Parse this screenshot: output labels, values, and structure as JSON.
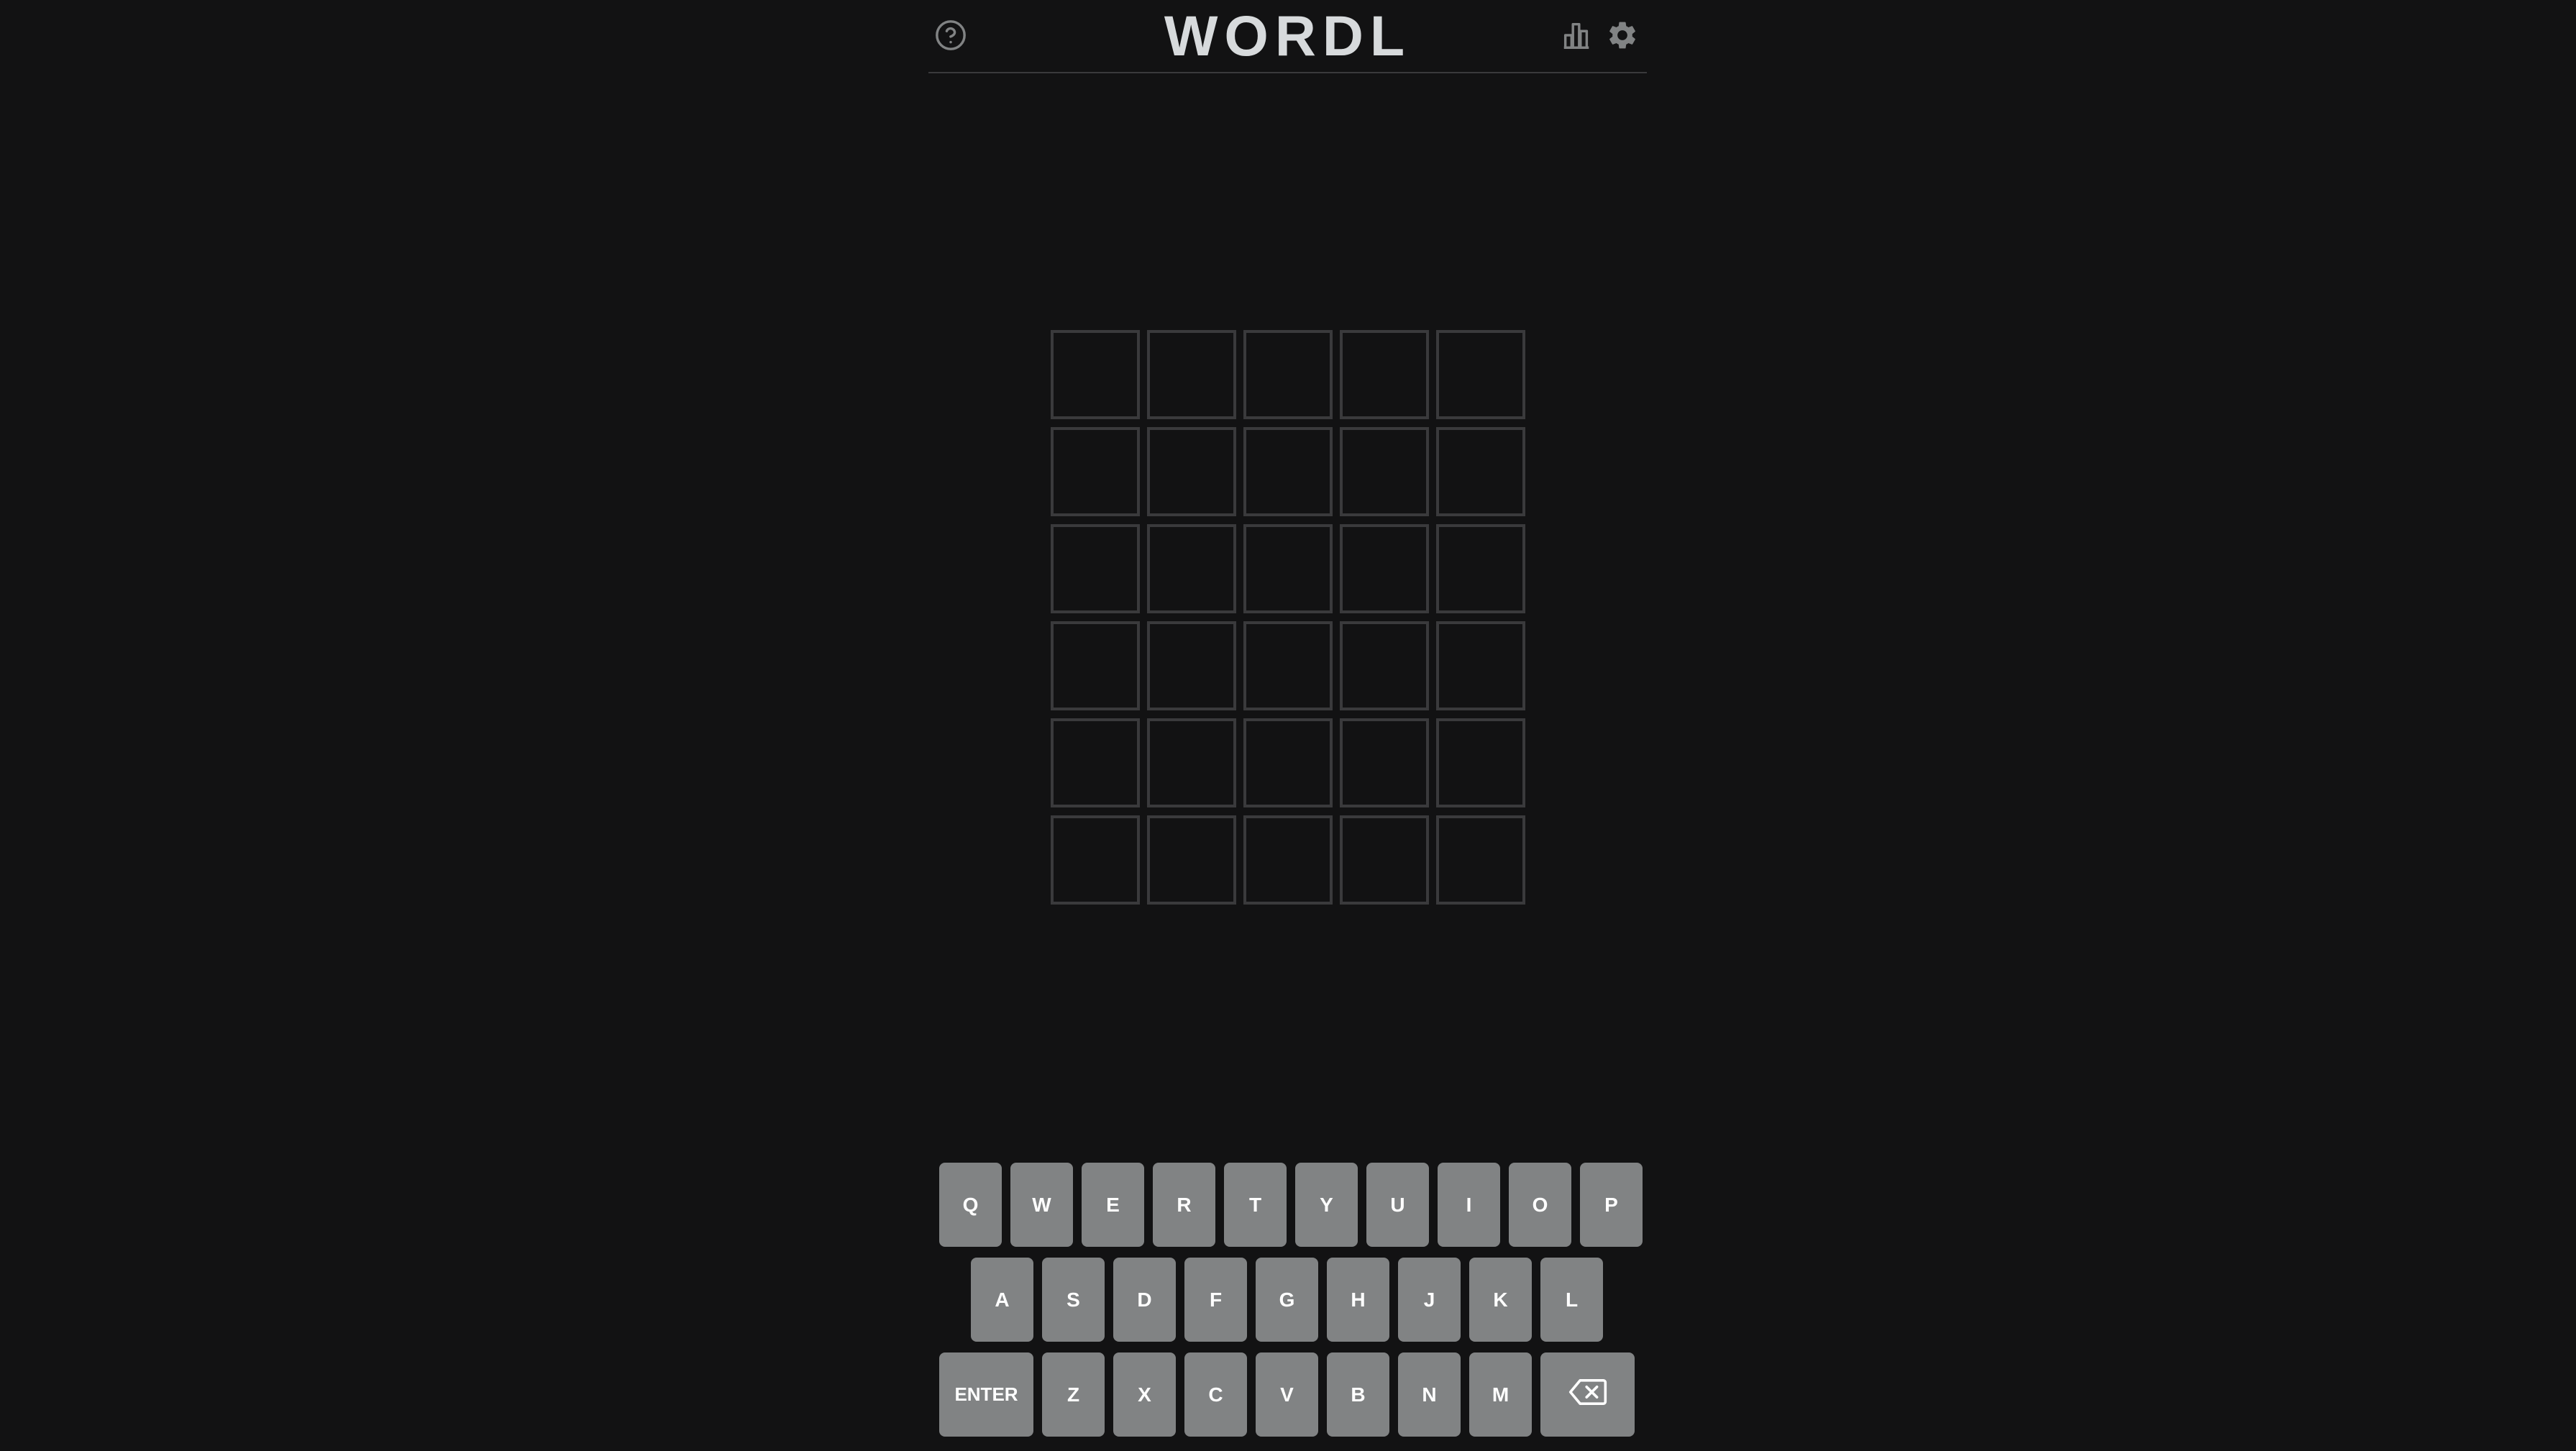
{
  "header": {
    "title": "WORDL",
    "icons": {
      "help": "help-circle-icon",
      "stats": "bar-chart-icon",
      "settings": "gear-icon"
    }
  },
  "board": {
    "rows": [
      [
        "",
        "",
        "",
        "",
        ""
      ],
      [
        "",
        "",
        "",
        "",
        ""
      ],
      [
        "",
        "",
        "",
        "",
        ""
      ],
      [
        "",
        "",
        "",
        "",
        ""
      ],
      [
        "",
        "",
        "",
        "",
        ""
      ],
      [
        "",
        "",
        "",
        "",
        ""
      ]
    ]
  },
  "keyboard": {
    "rows": [
      [
        "Q",
        "W",
        "E",
        "R",
        "T",
        "Y",
        "U",
        "I",
        "O",
        "P"
      ],
      [
        "A",
        "S",
        "D",
        "F",
        "G",
        "H",
        "J",
        "K",
        "L"
      ],
      [
        "ENTER",
        "Z",
        "X",
        "C",
        "V",
        "B",
        "N",
        "M",
        "⌫"
      ]
    ],
    "backspace_icon": "backspace-icon"
  },
  "colors": {
    "background": "#121213",
    "tile_border": "#3a3a3c",
    "key": "#818384",
    "text": "#d7dadc"
  }
}
